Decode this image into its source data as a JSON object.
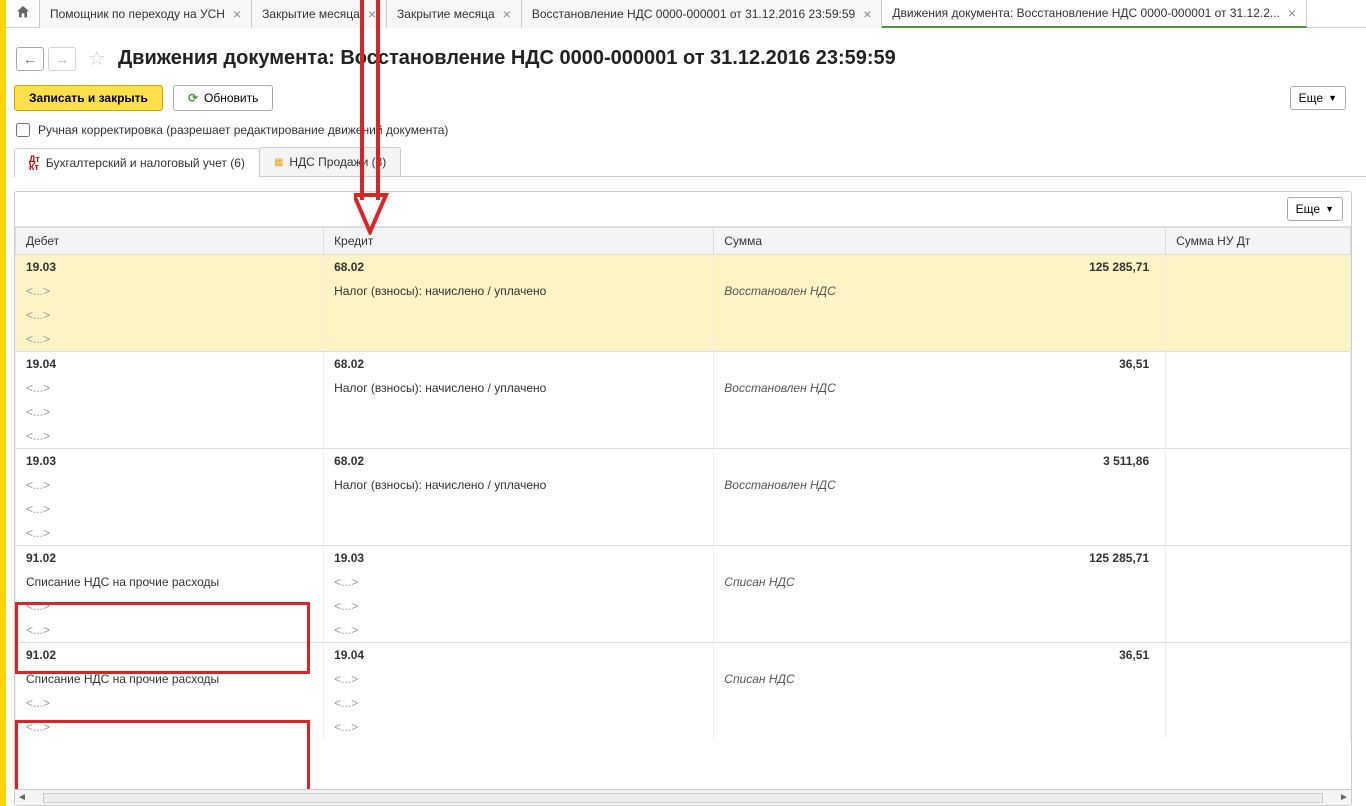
{
  "tabs": [
    {
      "label": "Помощник по переходу на УСН"
    },
    {
      "label": "Закрытие месяца"
    },
    {
      "label": "Закрытие месяца"
    },
    {
      "label": "Восстановление НДС 0000-000001 от 31.12.2016 23:59:59"
    },
    {
      "label": "Движения документа: Восстановление НДС 0000-000001 от 31.12.2..."
    }
  ],
  "title": "Движения документа: Восстановление НДС 0000-000001 от 31.12.2016 23:59:59",
  "toolbar": {
    "save_close": "Записать и закрыть",
    "refresh": "Обновить",
    "more": "Еще"
  },
  "checkbox_label": "Ручная корректировка (разрешает редактирование движений документа)",
  "inner_tabs": [
    {
      "label": "Бухгалтерский и налоговый учет (6)"
    },
    {
      "label": "НДС Продажи (3)"
    }
  ],
  "columns": {
    "debit": "Дебет",
    "credit": "Кредит",
    "sum": "Сумма",
    "sumnu": "Сумма НУ Дт"
  },
  "placeholder": "<...>",
  "rows": [
    {
      "highlight": true,
      "debit_acc": "19.03",
      "credit_acc": "68.02",
      "sum": "125 285,71",
      "credit_desc": "Налог (взносы): начислено / уплачено",
      "sum_note": "Восстановлен НДС"
    },
    {
      "debit_acc": "19.04",
      "credit_acc": "68.02",
      "sum": "36,51",
      "credit_desc": "Налог (взносы): начислено / уплачено",
      "sum_note": "Восстановлен НДС"
    },
    {
      "debit_acc": "19.03",
      "credit_acc": "68.02",
      "sum": "3 511,86",
      "credit_desc": "Налог (взносы): начислено / уплачено",
      "sum_note": "Восстановлен НДС"
    },
    {
      "debit_acc": "91.02",
      "debit_desc": "Списание НДС на прочие расходы",
      "credit_acc": "19.03",
      "sum": "125 285,71",
      "sum_note": "Списан НДС"
    },
    {
      "debit_acc": "91.02",
      "debit_desc": "Списание НДС на прочие расходы",
      "credit_acc": "19.04",
      "sum": "36,51",
      "sum_note": "Списан НДС"
    }
  ]
}
